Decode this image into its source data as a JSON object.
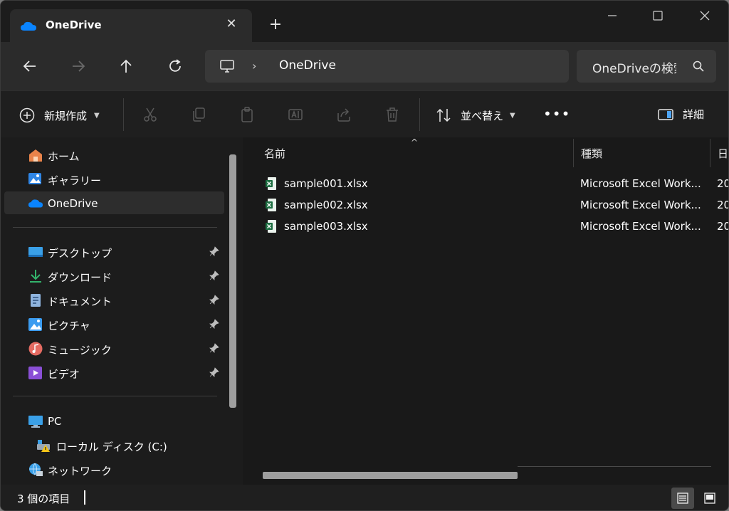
{
  "tab": {
    "title": "OneDrive"
  },
  "address": {
    "location": "OneDrive"
  },
  "search": {
    "placeholder": "OneDriveの検索"
  },
  "toolbar": {
    "new_label": "新規作成",
    "sort_label": "並べ替え",
    "more_label": "•••",
    "details_label": "詳細"
  },
  "sidebar": {
    "items": [
      {
        "label": "ホーム",
        "icon": "home-icon"
      },
      {
        "label": "ギャラリー",
        "icon": "gallery-icon"
      },
      {
        "label": "OneDrive",
        "icon": "onedrive-icon",
        "selected": true
      },
      {
        "label": "デスクトップ",
        "icon": "desktop-icon",
        "pinned": true
      },
      {
        "label": "ダウンロード",
        "icon": "download-icon",
        "pinned": true
      },
      {
        "label": "ドキュメント",
        "icon": "documents-icon",
        "pinned": true
      },
      {
        "label": "ピクチャ",
        "icon": "pictures-icon",
        "pinned": true
      },
      {
        "label": "ミュージック",
        "icon": "music-icon",
        "pinned": true
      },
      {
        "label": "ビデオ",
        "icon": "videos-icon",
        "pinned": true
      },
      {
        "label": "PC",
        "icon": "pc-icon"
      },
      {
        "label": "ローカル ディスク (C:)",
        "icon": "local-disk-icon"
      },
      {
        "label": "ネットワーク",
        "icon": "network-icon"
      }
    ]
  },
  "columns": {
    "name": "名前",
    "type": "種類",
    "date": "日"
  },
  "files": [
    {
      "name": "sample001.xlsx",
      "type": "Microsoft Excel Work...",
      "date": "20"
    },
    {
      "name": "sample002.xlsx",
      "type": "Microsoft Excel Work...",
      "date": "20"
    },
    {
      "name": "sample003.xlsx",
      "type": "Microsoft Excel Work...",
      "date": "20"
    }
  ],
  "status": {
    "item_count": "3 個の項目"
  },
  "colors": {
    "accent": "#0078d4",
    "excel_green": "#1d6f42",
    "window_bg": "#202020"
  }
}
